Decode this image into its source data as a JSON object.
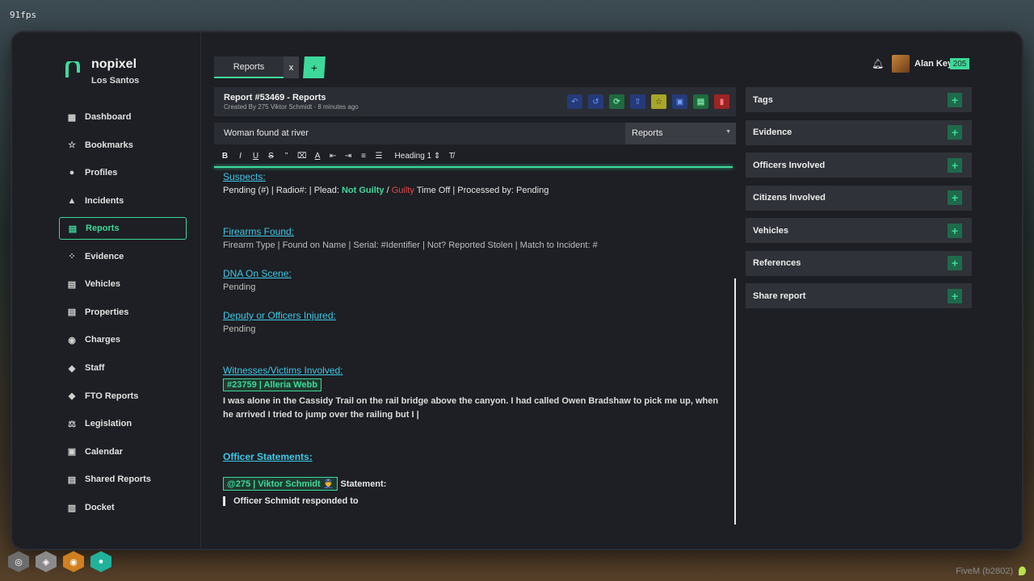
{
  "overlay": {
    "fps": "91fps",
    "fivem": "FiveM (b2802)"
  },
  "brand": {
    "name": "nopixel",
    "city": "Los Santos"
  },
  "sidebar": {
    "items": [
      {
        "label": "Dashboard",
        "icon": "dashboard-icon"
      },
      {
        "label": "Bookmarks",
        "icon": "star-icon"
      },
      {
        "label": "Profiles",
        "icon": "user-icon"
      },
      {
        "label": "Incidents",
        "icon": "alert-icon"
      },
      {
        "label": "Reports",
        "icon": "file-icon",
        "active": true
      },
      {
        "label": "Evidence",
        "icon": "footprints-icon"
      },
      {
        "label": "Vehicles",
        "icon": "car-icon"
      },
      {
        "label": "Properties",
        "icon": "building-icon"
      },
      {
        "label": "Charges",
        "icon": "pin-icon"
      },
      {
        "label": "Staff",
        "icon": "cap-icon"
      },
      {
        "label": "FTO Reports",
        "icon": "cap-icon"
      },
      {
        "label": "Legislation",
        "icon": "gavel-icon"
      },
      {
        "label": "Calendar",
        "icon": "calendar-icon"
      },
      {
        "label": "Shared Reports",
        "icon": "file-icon"
      },
      {
        "label": "Docket",
        "icon": "docket-icon"
      }
    ]
  },
  "tabs": [
    {
      "label": "Reports",
      "close": "x"
    }
  ],
  "user": {
    "name": "Alan Key",
    "badge": "205"
  },
  "report": {
    "title": "Report #53469 - Reports",
    "subtitle": "Created By 275 Viktor Schmidt · 8 minutes ago",
    "name_value": "Woman found at river",
    "type_select": "Reports"
  },
  "toolbar": {
    "bold": "B",
    "italic": "I",
    "underline": "U",
    "strike": "S",
    "quote": "”",
    "heading": "Heading 1"
  },
  "editor": {
    "suspects_h": "Suspects:",
    "suspects_line": {
      "p1": "Pending (#) | Radio#: | Plead: ",
      "not_guilty": "Not Guilty",
      "slash": " / ",
      "guilty": "Guilty",
      "p2": "  Time Off | Processed by: Pending"
    },
    "firearms_h": "Firearms Found:",
    "firearms_line": "Firearm Type | Found on Name | Serial: #Identifier | Not? Reported Stolen | Match to Incident: #",
    "dna_h": "DNA On Scene:",
    "dna_val": "Pending",
    "injured_h": "Deputy or Officers Injured:",
    "injured_val": "Pending",
    "witnesses_h": "Witnesses/Victims Involved:",
    "witness_chip": "#23759 | Alleria Webb",
    "witness_text": "I was alone in the Cassidy Trail on the rail bridge above the canyon. I had called Owen Bradshaw to pick me up, when he arrived I tried to jump over the railing but I |",
    "officer_h": "Officer Statements:",
    "officer_chip": "@275 | Viktor Schmidt 👮",
    "statement_label": " Statement:",
    "officer_quote": "Officer Schmidt responded to"
  },
  "panels": [
    {
      "label": "Tags"
    },
    {
      "label": "Evidence"
    },
    {
      "label": "Officers Involved"
    },
    {
      "label": "Citizens Involved"
    },
    {
      "label": "Vehicles"
    },
    {
      "label": "References"
    },
    {
      "label": "Share report"
    }
  ],
  "colors": {
    "accent": "#3ed99a",
    "link": "#3ec8e6",
    "danger": "#e04848"
  }
}
